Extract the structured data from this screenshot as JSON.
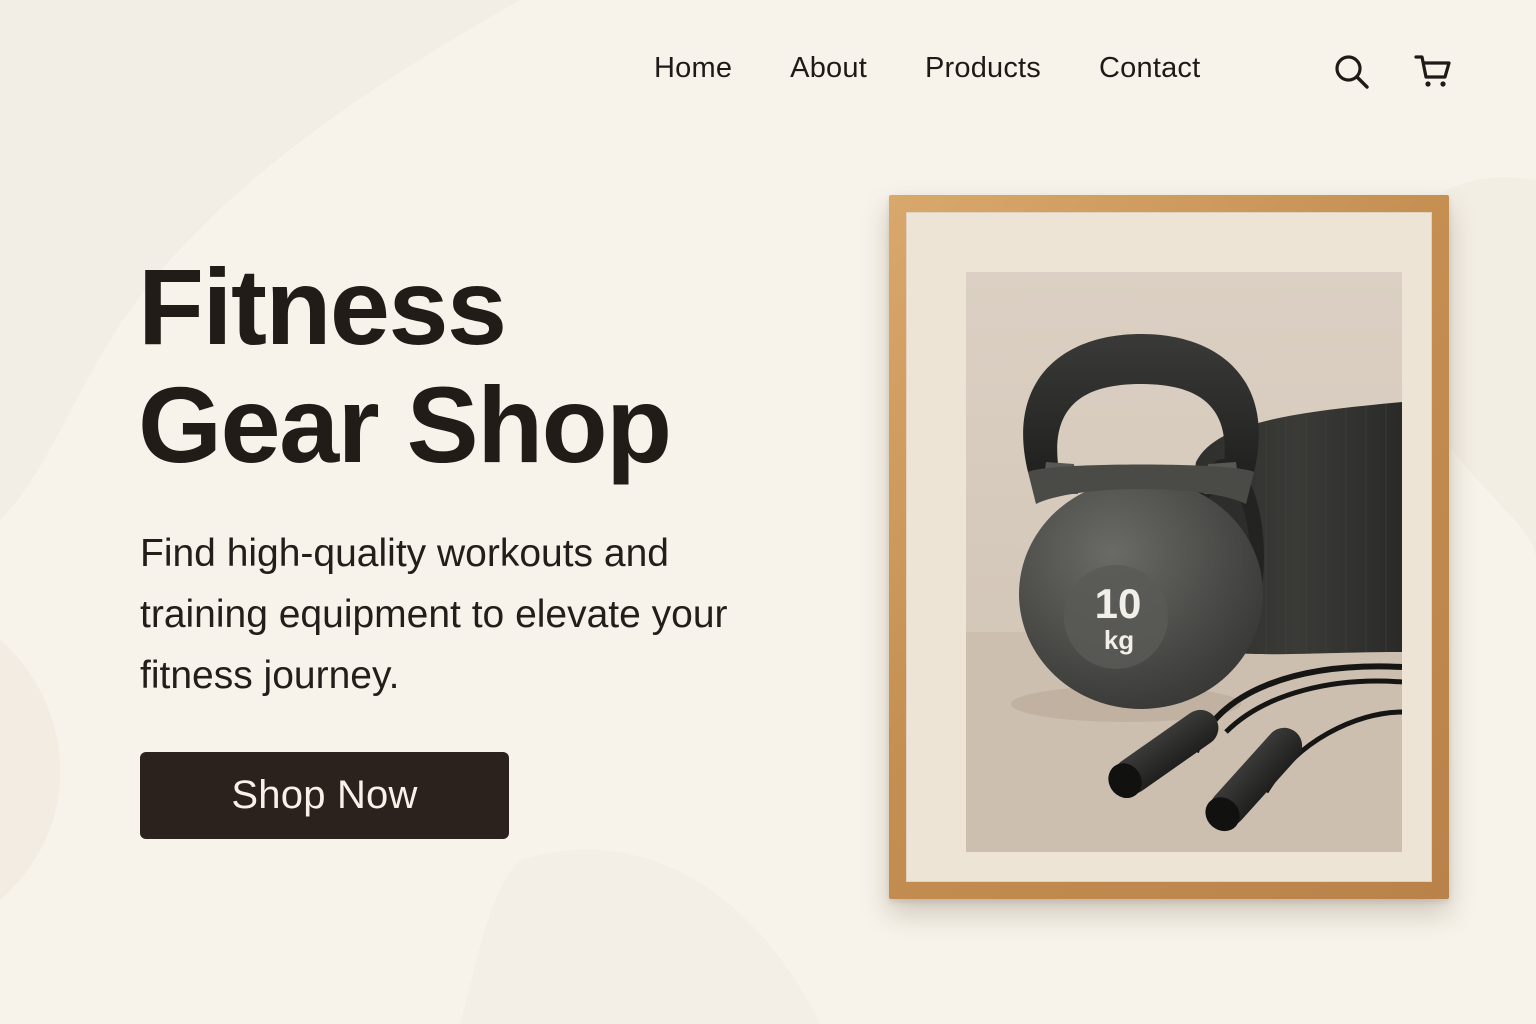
{
  "nav": {
    "items": [
      "Home",
      "About",
      "Products",
      "Contact"
    ],
    "icons": [
      "search-icon",
      "cart-icon"
    ]
  },
  "hero": {
    "title_line1": "Fitness",
    "title_line2": "Gear Shop",
    "subtitle": "Find high-quality workouts and training equipment to elevate your fitness journey.",
    "cta_label": "Shop Now"
  },
  "image": {
    "kettlebell_label_number": "10",
    "kettlebell_label_unit": "kg"
  },
  "colors": {
    "background": "#f7f3ea",
    "text": "#1f1a17",
    "button": "#2b211d",
    "frame_wood": "#c89457"
  }
}
